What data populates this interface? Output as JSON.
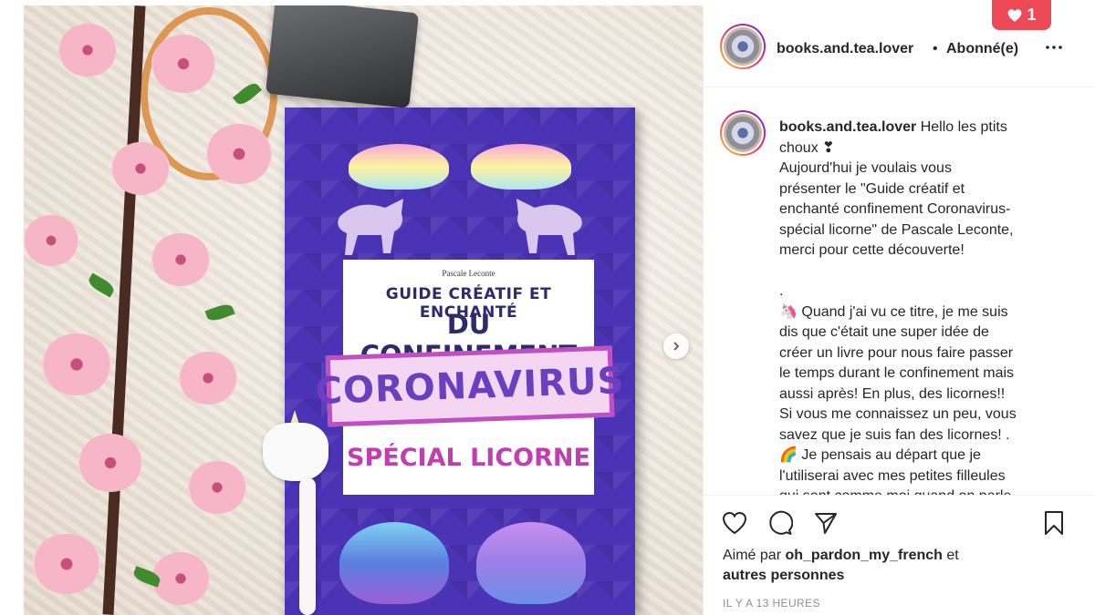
{
  "post": {
    "username": "books.and.tea.lover",
    "follow_status": "Abonné(e)",
    "separator": "•",
    "more_icon": "more-horizontal-icon"
  },
  "photo": {
    "book": {
      "author": "Pascale Leconte",
      "title_line1": "GUIDE CRÉATIF ET ENCHANTÉ",
      "title_line2": "DU CONFINEMENT",
      "stamp": "CORONAVIRUS",
      "subtitle": "SPÉCIAL LICORNE"
    },
    "next_icon": "chevron-right-icon"
  },
  "caption": {
    "username": "books.and.tea.lover",
    "text": " Hello les ptits\nchoux ❣\nAujourd'hui je voulais vous\nprésenter le \"Guide créatif et\nenchanté confinement Coronavirus-\nspécial licorne\" de Pascale Leconte,\nmerci pour cette découverte!\n\n.\n🦄 Quand j'ai vu ce titre, je me suis\ndis que c'était une super idée de\ncréer un livre pour nous faire passer\nle temps durant le confinement mais\naussi après! En plus, des licornes!!\nSi vous me connaissez un peu, vous\nsavez que je suis fan des licornes! .\n🌈 Je pensais au départ que je\nl'utiliserai avec mes petites filleules\nqui sont comme moi quand on parle\nde licorne! Et finalement je"
  },
  "actions": {
    "like_icon": "heart-icon",
    "comment_icon": "comment-icon",
    "share_icon": "send-icon",
    "save_icon": "bookmark-icon"
  },
  "likes": {
    "prefix": "Aimé par ",
    "user": "oh_pardon_my_french",
    "middle": " et",
    "others": "autres personnes"
  },
  "timestamp": "IL Y A 13 HEURES",
  "notification": {
    "icon": "heart-icon",
    "count": "1",
    "color": "#ed4956"
  }
}
